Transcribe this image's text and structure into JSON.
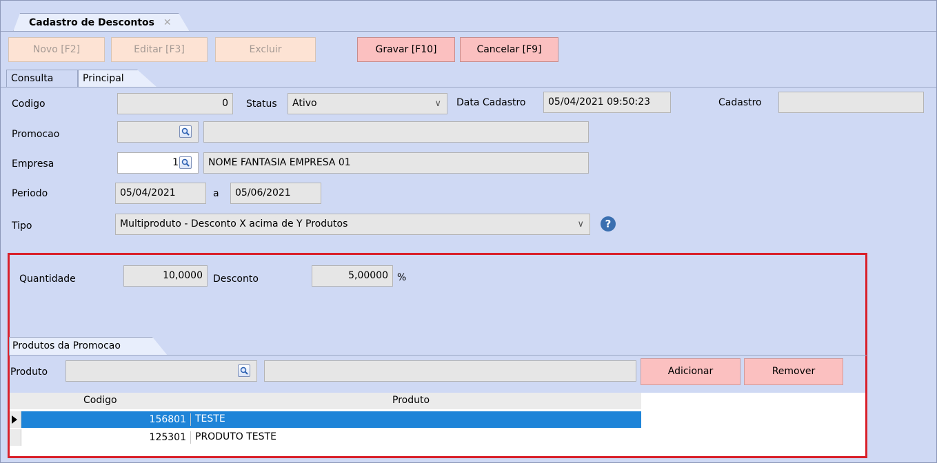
{
  "window": {
    "doc_tab_label": "Cadastro de Descontos",
    "doc_tab_close": "✕"
  },
  "toolbar": {
    "novo": "Novo [F2]",
    "editar": "Editar [F3]",
    "excluir": "Excluir",
    "gravar": "Gravar [F10]",
    "cancelar": "Cancelar [F9]"
  },
  "tabs": {
    "consulta": "Consulta",
    "principal": "Principal"
  },
  "form": {
    "codigo_label": "Codigo",
    "codigo_value": "0",
    "status_label": "Status",
    "status_value": "Ativo",
    "data_cadastro_label": "Data Cadastro",
    "data_cadastro_value": "05/04/2021 09:50:23",
    "cadastro_label": "Cadastro",
    "cadastro_value": "",
    "promocao_label": "Promocao",
    "promocao_code": "",
    "promocao_name": "",
    "empresa_label": "Empresa",
    "empresa_code": "1",
    "empresa_name": "NOME FANTASIA EMPRESA 01",
    "periodo_label": "Periodo",
    "periodo_start": "05/04/2021",
    "periodo_sep": "a",
    "periodo_end": "05/06/2021",
    "tipo_label": "Tipo",
    "tipo_value": "Multiproduto - Desconto X acima de Y Produtos",
    "help_glyph": "?"
  },
  "desconto": {
    "quantidade_label": "Quantidade",
    "quantidade_value": "10,0000",
    "desconto_label": "Desconto",
    "desconto_value": "5,00000",
    "percent_label": "%"
  },
  "produtos": {
    "tab_label": "Produtos da Promocao",
    "produto_label": "Produto",
    "produto_code": "",
    "produto_name": "",
    "adicionar": "Adicionar",
    "remover": "Remover",
    "columns": [
      "Codigo",
      "Produto"
    ],
    "rows": [
      {
        "codigo": "156801",
        "produto": "TESTE"
      },
      {
        "codigo": "125301",
        "produto": "PRODUTO TESTE"
      }
    ]
  },
  "colors": {
    "background": "#cfd9f4",
    "highlight_border": "#d9202a",
    "selected_row": "#1e84d8",
    "active_button": "#fbc0c0",
    "disabled_button": "#fde3d4"
  }
}
